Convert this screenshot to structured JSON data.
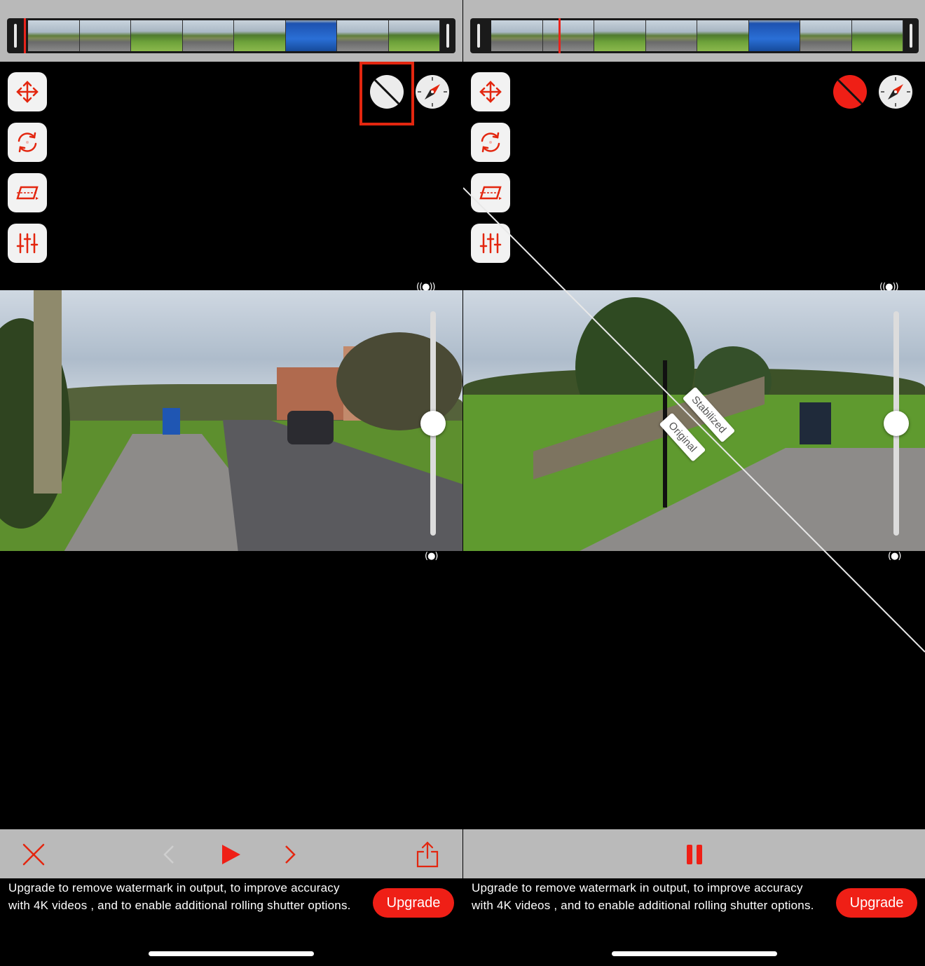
{
  "panes": [
    {
      "id": "left",
      "top_right_buttons": {
        "compare": {
          "icon": "split-compare-icon",
          "state": "off",
          "highlighted": true
        },
        "compass": {
          "icon": "compass-icon"
        }
      },
      "controls": {
        "close_icon": "close-icon",
        "prev_icon": "chevron-left-icon",
        "play_icon": "play-icon",
        "next_icon": "chevron-right-icon",
        "share_icon": "share-icon"
      }
    },
    {
      "id": "right",
      "top_right_buttons": {
        "compare": {
          "icon": "split-compare-icon",
          "state": "on"
        },
        "compass": {
          "icon": "compass-icon"
        }
      },
      "video_tags": {
        "stabilized": "Stabilized",
        "original": "Original"
      },
      "controls": {
        "pause_icon": "pause-icon"
      }
    }
  ],
  "tools": [
    "move-icon",
    "rotate-icon",
    "perspective-crop-icon",
    "adjustments-icon"
  ],
  "slider": {
    "top_icon": "((●))",
    "bottom_icon": "(●)",
    "level": 0.5
  },
  "banner": {
    "text": "Upgrade to remove watermark in output, to improve accuracy with 4K videos , and to enable additional rolling shutter options.",
    "button": "Upgrade"
  },
  "colors": {
    "accent": "#ef1f16",
    "toolbar": "#bababa",
    "filmstrip_bg": "#b9b9b9"
  }
}
